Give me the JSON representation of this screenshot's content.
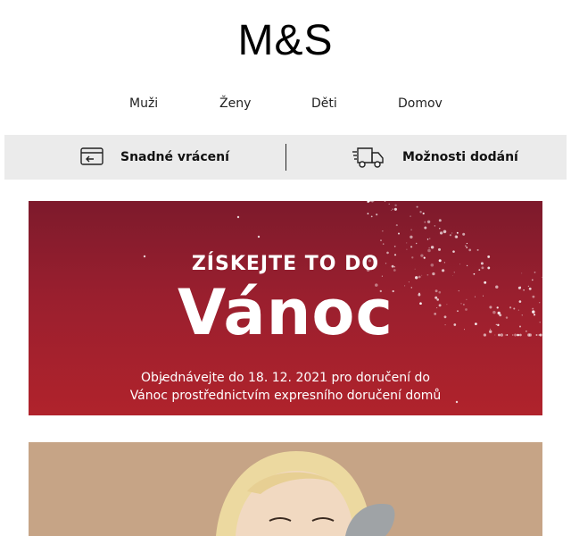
{
  "brand": {
    "logo_text": "M&S"
  },
  "nav": {
    "items": [
      {
        "label": "Muži"
      },
      {
        "label": "Ženy"
      },
      {
        "label": "Děti"
      },
      {
        "label": "Domov"
      }
    ]
  },
  "info_bar": {
    "returns_label": "Snadné vrácení",
    "returns_icon": "returns-card-icon",
    "delivery_label": "Možnosti dodání",
    "delivery_icon": "delivery-truck-icon",
    "background_color": "#ebebeb"
  },
  "hero": {
    "kicker": "ZÍSKEJTE TO DO",
    "headline": "Vánoc",
    "subtext_line1": "Objednávejte do 18. 12. 2021 pro doručení do",
    "subtext_line2": "Vánoc prostřednictvím expresního doručení domů",
    "background_color": "#9a1f2e"
  }
}
